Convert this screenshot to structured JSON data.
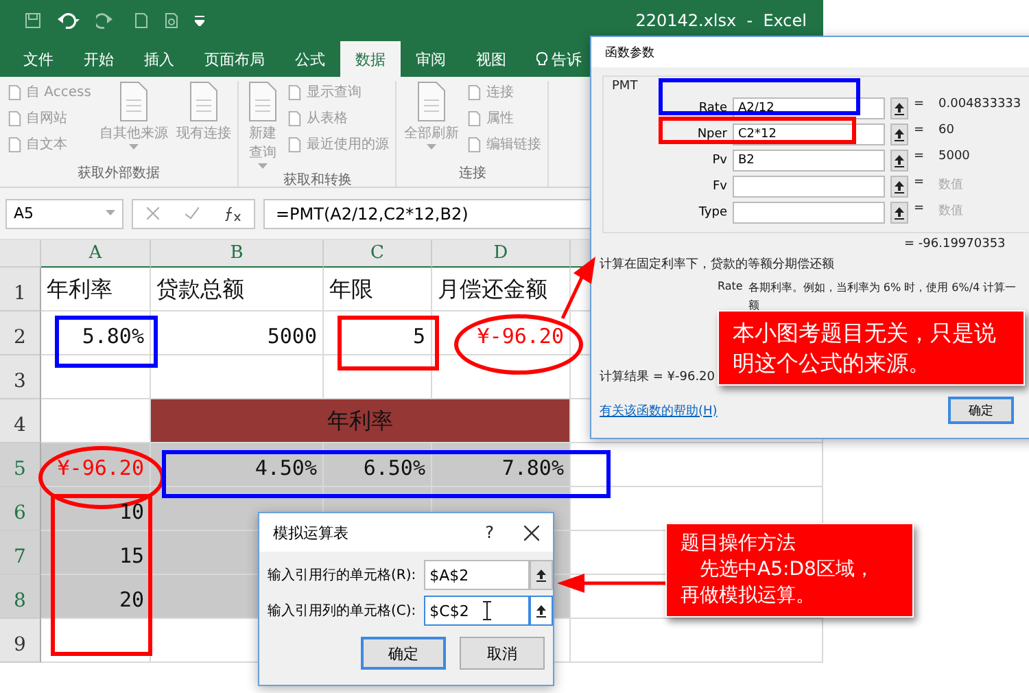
{
  "window": {
    "title": "220142.xlsx  -  Excel"
  },
  "tabs": [
    {
      "label": "文件",
      "selected": false
    },
    {
      "label": "开始",
      "selected": false
    },
    {
      "label": "插入",
      "selected": false
    },
    {
      "label": "页面布局",
      "selected": false
    },
    {
      "label": "公式",
      "selected": false
    },
    {
      "label": "数据",
      "selected": true
    },
    {
      "label": "审阅",
      "selected": false
    },
    {
      "label": "视图",
      "selected": false
    },
    {
      "label": "告诉",
      "selected": false,
      "kind": "tell"
    }
  ],
  "ribbon": {
    "groups": [
      {
        "label": "获取外部数据",
        "items": [
          {
            "kind": "stack",
            "entries": [
              "自 Access",
              "自网站",
              "自文本"
            ]
          },
          {
            "kind": "large",
            "label": "自其他来源",
            "dropdown": true
          },
          {
            "kind": "large",
            "label": "现有连接",
            "dropdown": false
          }
        ]
      },
      {
        "label": "获取和转换",
        "items": [
          {
            "kind": "large",
            "label": "新建查询",
            "dropdown": true
          },
          {
            "kind": "stack",
            "entries": [
              "显示查询",
              "从表格",
              "最近使用的源"
            ]
          }
        ]
      },
      {
        "label": "连接",
        "items": [
          {
            "kind": "large",
            "label": "全部刷新",
            "dropdown": true
          },
          {
            "kind": "stack",
            "entries": [
              "连接",
              "属性",
              "编辑链接"
            ]
          }
        ]
      }
    ]
  },
  "formula_bar": {
    "name_box": "A5",
    "formula": "=PMT(A2/12,C2*12,B2)"
  },
  "sheet": {
    "columns": [
      "A",
      "B",
      "C",
      "D"
    ],
    "rows": [
      {
        "label": "1",
        "selected": false,
        "cells": [
          {
            "kind": "text",
            "text": "年利率"
          },
          {
            "kind": "text",
            "text": "贷款总额"
          },
          {
            "kind": "text",
            "text": "年限"
          },
          {
            "kind": "text",
            "text": "月偿还金额"
          }
        ]
      },
      {
        "label": "2",
        "selected": false,
        "cells": [
          {
            "kind": "number",
            "text": "5.80%"
          },
          {
            "kind": "number",
            "text": "5000"
          },
          {
            "kind": "number",
            "text": "5"
          },
          {
            "kind": "currency",
            "text": "¥-96.20"
          }
        ]
      },
      {
        "label": "3",
        "selected": false,
        "cells": []
      },
      {
        "label": "4",
        "selected": false,
        "cells": [
          {
            "kind": "empty"
          },
          {
            "kind": "band",
            "text": "年利率"
          }
        ]
      },
      {
        "label": "5",
        "selected": true,
        "cells": [
          {
            "kind": "currency",
            "text": "¥-96.20"
          },
          {
            "kind": "number",
            "text": "4.50%"
          },
          {
            "kind": "number",
            "text": "6.50%"
          },
          {
            "kind": "number",
            "text": "7.80%"
          }
        ]
      },
      {
        "label": "6",
        "selected": true,
        "cells": [
          {
            "kind": "number",
            "text": "10"
          }
        ]
      },
      {
        "label": "7",
        "selected": true,
        "cells": [
          {
            "kind": "number",
            "text": "15"
          }
        ]
      },
      {
        "label": "8",
        "selected": true,
        "cells": [
          {
            "kind": "number",
            "text": "20"
          }
        ]
      },
      {
        "label": "9",
        "selected": false,
        "cells": []
      }
    ]
  },
  "function_dialog": {
    "title": "函数参数",
    "function": "PMT",
    "equals_sign": "=",
    "args": [
      {
        "name": "Rate",
        "value": "A2/12",
        "result": "0.004833333"
      },
      {
        "name": "Nper",
        "value": "C2*12",
        "result": "60"
      },
      {
        "name": "Pv",
        "value": "B2",
        "result": "5000"
      },
      {
        "name": "Fv",
        "result_hint": "数值"
      },
      {
        "name": "Type",
        "result_hint": "数值"
      }
    ],
    "total": "= -96.19970353",
    "description": "计算在固定利率下，贷款的等额分期偿还额",
    "arg_help_name": "Rate",
    "arg_help": [
      "各期利率。例如，当利率为 6% 时，使用 6%/4 计算一",
      "额"
    ],
    "result": "计算结果 =  ¥-96.20",
    "help_link": "有关该函数的帮助(H)",
    "ok": "确定"
  },
  "table_dialog": {
    "title": "模拟运算表",
    "help": "?",
    "fields": [
      {
        "label": "输入引用行的单元格(R):",
        "value": "$A$2"
      },
      {
        "label": "输入引用列的单元格(C):",
        "value": "$C$2"
      }
    ],
    "buttons": [
      "确定",
      "取消"
    ]
  },
  "callouts": [
    {
      "lines": [
        "本小图考题目无关，只是说",
        "明这个公式的来源。"
      ]
    },
    {
      "lines": [
        "题目操作方法",
        "　先选中A5:D8区域，",
        "再做模拟运算。"
      ]
    }
  ]
}
